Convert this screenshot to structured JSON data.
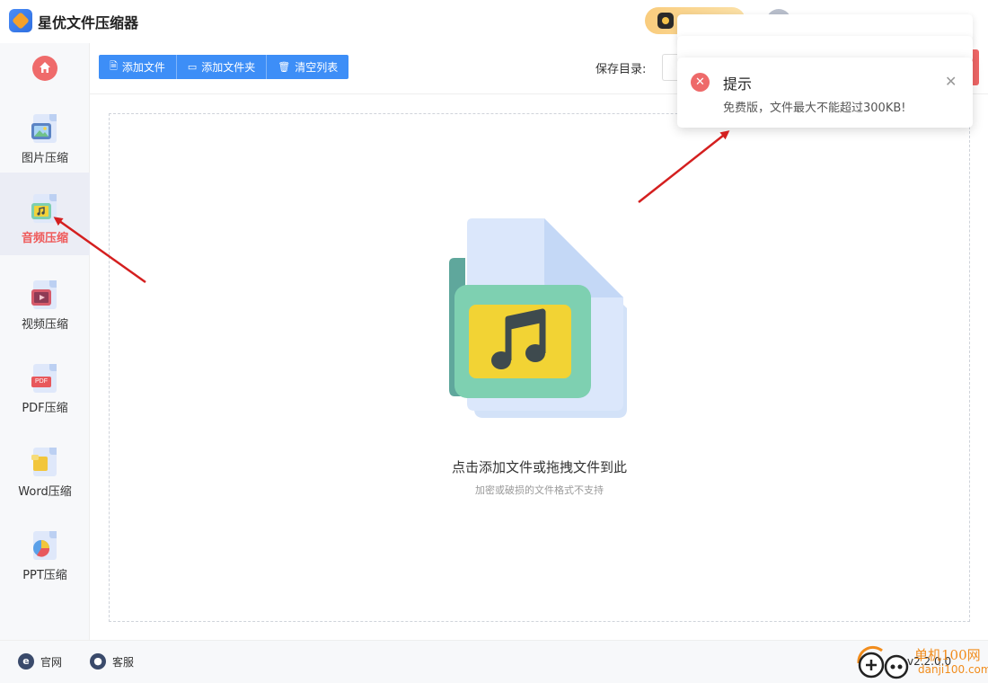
{
  "app": {
    "title": "星优文件压缩器"
  },
  "sidebar": {
    "items": [
      {
        "label": "图片压缩",
        "icon": "image-file-icon"
      },
      {
        "label": "音频压缩",
        "icon": "audio-file-icon",
        "active": true
      },
      {
        "label": "视频压缩",
        "icon": "video-file-icon"
      },
      {
        "label": "PDF压缩",
        "icon": "pdf-file-icon",
        "badge": "PDF"
      },
      {
        "label": "Word压缩",
        "icon": "word-file-icon"
      },
      {
        "label": "PPT压缩",
        "icon": "ppt-file-icon"
      }
    ]
  },
  "toolbar": {
    "add_file": "添加文件",
    "add_folder": "添加文件夹",
    "clear_list": "清空列表",
    "save_dir_label": "保存目录:"
  },
  "dropzone": {
    "main_text": "点击添加文件或拖拽文件到此",
    "sub_text": "加密或破损的文件格式不支持"
  },
  "toast": {
    "title": "提示",
    "message": "免费版，文件最大不能超过300KB!",
    "icon": "error-icon"
  },
  "footer": {
    "website": "官网",
    "support": "客服",
    "version": "v2.2.0.0"
  },
  "watermark": {
    "text": "单机100网",
    "url": "danji100.com"
  },
  "colors": {
    "accent": "#3d8ef7",
    "active_text": "#ef5a5a",
    "error": "#ee6a6a",
    "arrow": "#d41f1f",
    "watermark": "#f18c1c"
  }
}
